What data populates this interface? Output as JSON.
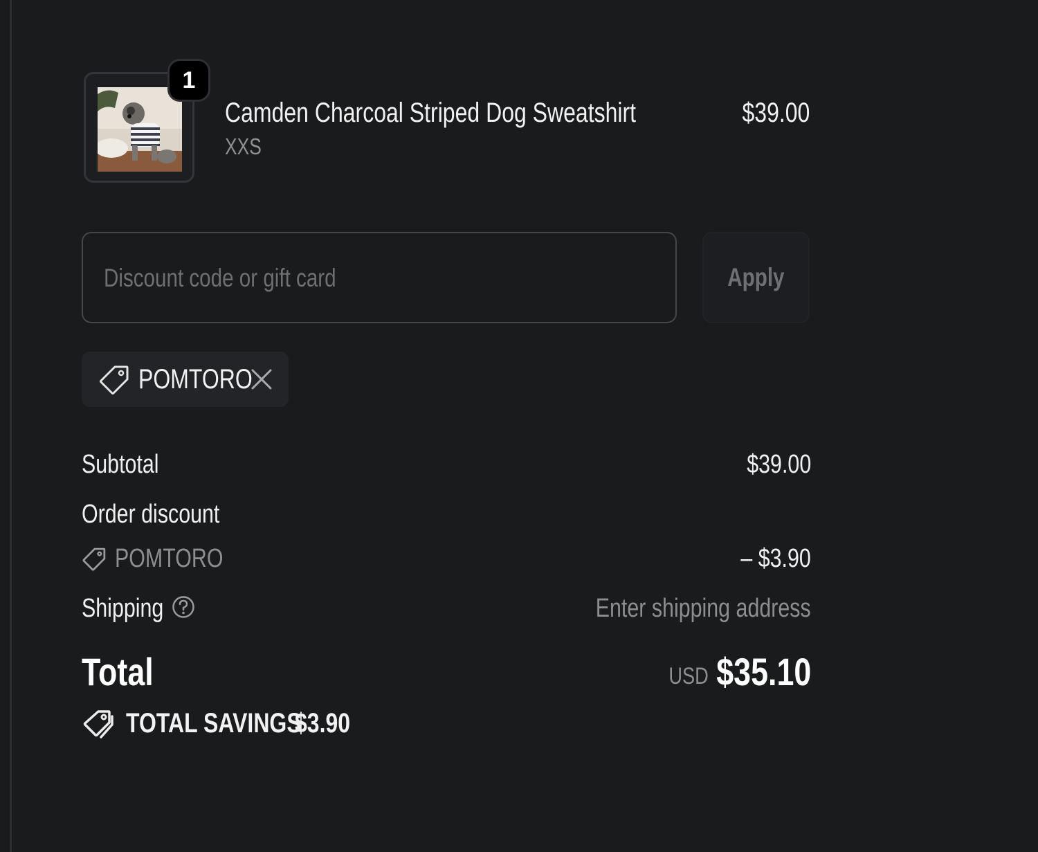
{
  "cart": {
    "item": {
      "quantity": "1",
      "name": "Camden Charcoal Striped Dog Sweatshirt",
      "variant": "XXS",
      "price": "$39.00",
      "image_icon": "dog-sweatshirt-photo"
    },
    "discount": {
      "placeholder": "Discount code or gift card",
      "apply_label": "Apply",
      "applied_code": "POMTORO",
      "remove_icon": "close-icon"
    },
    "summary": {
      "subtotal_label": "Subtotal",
      "subtotal_value": "$39.00",
      "order_discount_label": "Order discount",
      "order_discount_code": "POMTORO",
      "order_discount_value": "– $3.90",
      "shipping_label": "Shipping",
      "shipping_value": "Enter shipping address",
      "total_label": "Total",
      "total_currency": "USD",
      "total_value": "$35.10",
      "savings_label": "TOTAL SAVINGS",
      "savings_value": "$3.90"
    }
  },
  "colors": {
    "background": "#1a1b1d",
    "text": "#ececec",
    "muted_text": "#8d8e92",
    "border": "#45474c",
    "chip_background": "#232428"
  }
}
